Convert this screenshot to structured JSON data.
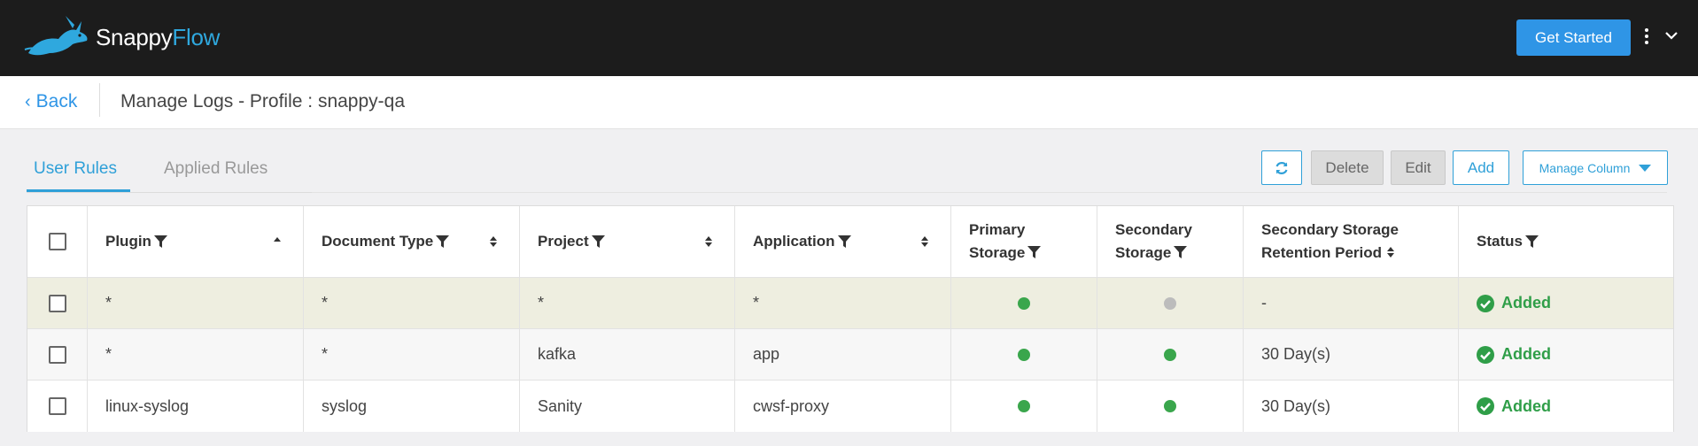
{
  "brand": {
    "name_part1": "Snappy",
    "name_part2": "Flow",
    "accent_color": "#2fa8de"
  },
  "topbar": {
    "get_started_label": "Get Started",
    "more_icon": "kebab-icon",
    "dropdown_icon": "chevron-down-icon"
  },
  "header": {
    "back_label": "Back",
    "title": "Manage Logs - Profile : snappy-qa"
  },
  "tabs": [
    {
      "label": "User Rules",
      "active": true
    },
    {
      "label": "Applied Rules",
      "active": false
    }
  ],
  "toolbar": {
    "refresh_icon": "refresh-icon",
    "delete_label": "Delete",
    "edit_label": "Edit",
    "add_label": "Add",
    "manage_column_label": "Manage Column"
  },
  "table": {
    "columns": [
      {
        "label": "Plugin",
        "filter": true,
        "sort": "asc"
      },
      {
        "label": "Document Type",
        "filter": true,
        "sort": "both"
      },
      {
        "label": "Project",
        "filter": true,
        "sort": "both"
      },
      {
        "label": "Application",
        "filter": true,
        "sort": "both"
      },
      {
        "label_line1": "Primary",
        "label_line2": "Storage",
        "filter": true
      },
      {
        "label_line1": "Secondary",
        "label_line2": "Storage",
        "filter": true
      },
      {
        "label_line1": "Secondary Storage",
        "label_line2": "Retention Period",
        "sort": "both"
      },
      {
        "label": "Status",
        "filter": true
      }
    ],
    "rows": [
      {
        "plugin": "*",
        "document_type": "*",
        "project": "*",
        "application": "*",
        "primary_storage": "enabled",
        "secondary_storage": "disabled",
        "retention": "-",
        "status": "Added"
      },
      {
        "plugin": "*",
        "document_type": "*",
        "project": "kafka",
        "application": "app",
        "primary_storage": "enabled",
        "secondary_storage": "enabled",
        "retention": "30 Day(s)",
        "status": "Added"
      },
      {
        "plugin": "linux-syslog",
        "document_type": "syslog",
        "project": "Sanity",
        "application": "cwsf-proxy",
        "primary_storage": "enabled",
        "secondary_storage": "enabled",
        "retention": "30 Day(s)",
        "status": "Added"
      }
    ]
  },
  "colors": {
    "status_green": "#3aa64c",
    "disabled_grey": "#bcbcbc",
    "primary_blue": "#2f95e6"
  }
}
